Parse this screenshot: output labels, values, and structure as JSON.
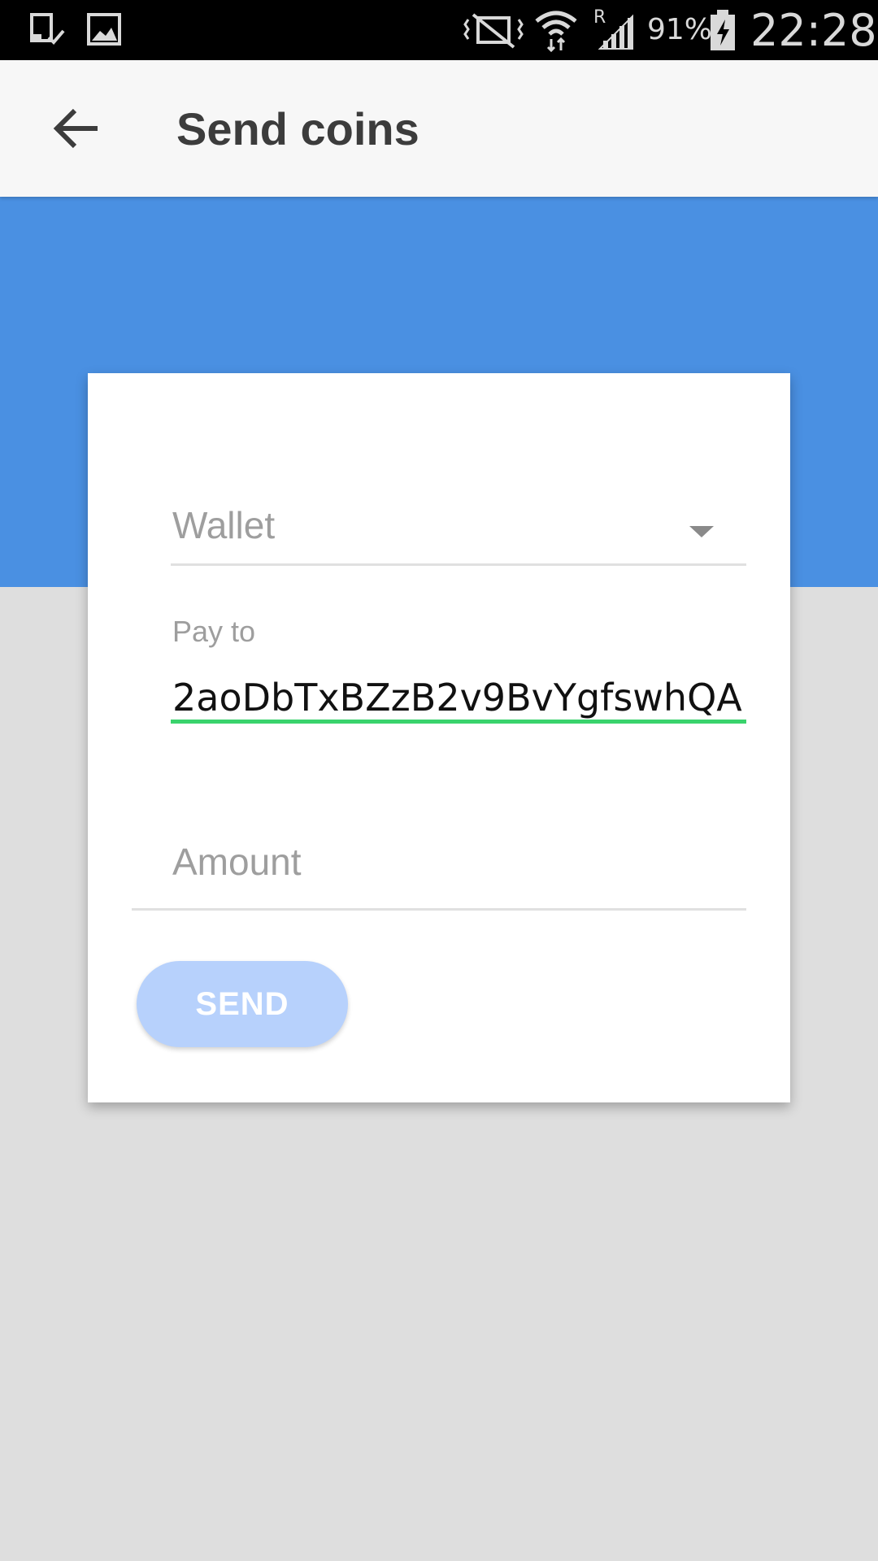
{
  "status_bar": {
    "left_icons": [
      "download-complete-icon",
      "image-icon"
    ],
    "right_icons": [
      "vibrate-mute-icon",
      "wifi-icon",
      "roaming-signal-icon",
      "battery-charging-icon"
    ],
    "roaming_indicator": "R",
    "battery_percent": "91%",
    "time": "22:28"
  },
  "app_bar": {
    "back_icon": "arrow-back-icon",
    "title": "Send coins"
  },
  "form": {
    "wallet": {
      "placeholder": "Wallet",
      "icon": "dropdown-arrow-icon"
    },
    "pay_to": {
      "label": "Pay to",
      "value": "2aoDbTxBZzB2v9BvYgfswhQA"
    },
    "amount": {
      "placeholder": "Amount"
    },
    "send_label": "SEND"
  },
  "colors": {
    "status_bar": "#000000",
    "app_bar": "#f7f7f7",
    "accent_band": "#4a90e2",
    "background": "#dedede",
    "active_underline": "#3ad36d",
    "send_button": "#b7d1fc"
  }
}
